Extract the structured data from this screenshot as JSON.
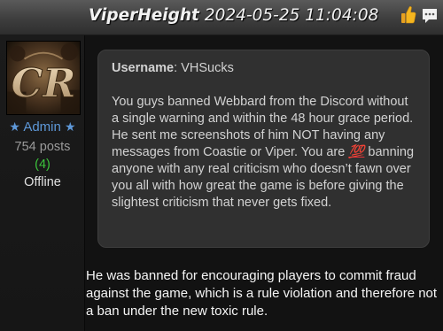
{
  "post": {
    "author": "ViperHeight",
    "timestamp": "2024-05-25 11:04:08"
  },
  "header_icons": [
    "thumbs-up-icon",
    "chat-bubble-icon"
  ],
  "user": {
    "avatar_letters": "CR",
    "rank": "Admin",
    "posts": "754 posts",
    "reputation": "(4)",
    "status": "Offline"
  },
  "quote": {
    "username_label": "Username",
    "username": "VHSucks",
    "text_before": "You guys banned Webbard from the Discord without a single warning and within the 48 hour grace period. He sent me screenshots of him NOT having any messages from Coastie or Viper. You are ",
    "emoji": "💯",
    "text_after": " banning anyone with any real criticism who doesn’t fawn over you all with how great the game is before giving the slightest criticism that never gets fixed."
  },
  "reply": "He was banned for encouraging players to commit fraud against the game, which is a rule violation and therefore not a ban under the new toxic rule.",
  "colors": {
    "rank": "#5e98d8",
    "reputation": "#3cc43c",
    "quote_bg": "#303030",
    "page_bg": "#121212"
  }
}
